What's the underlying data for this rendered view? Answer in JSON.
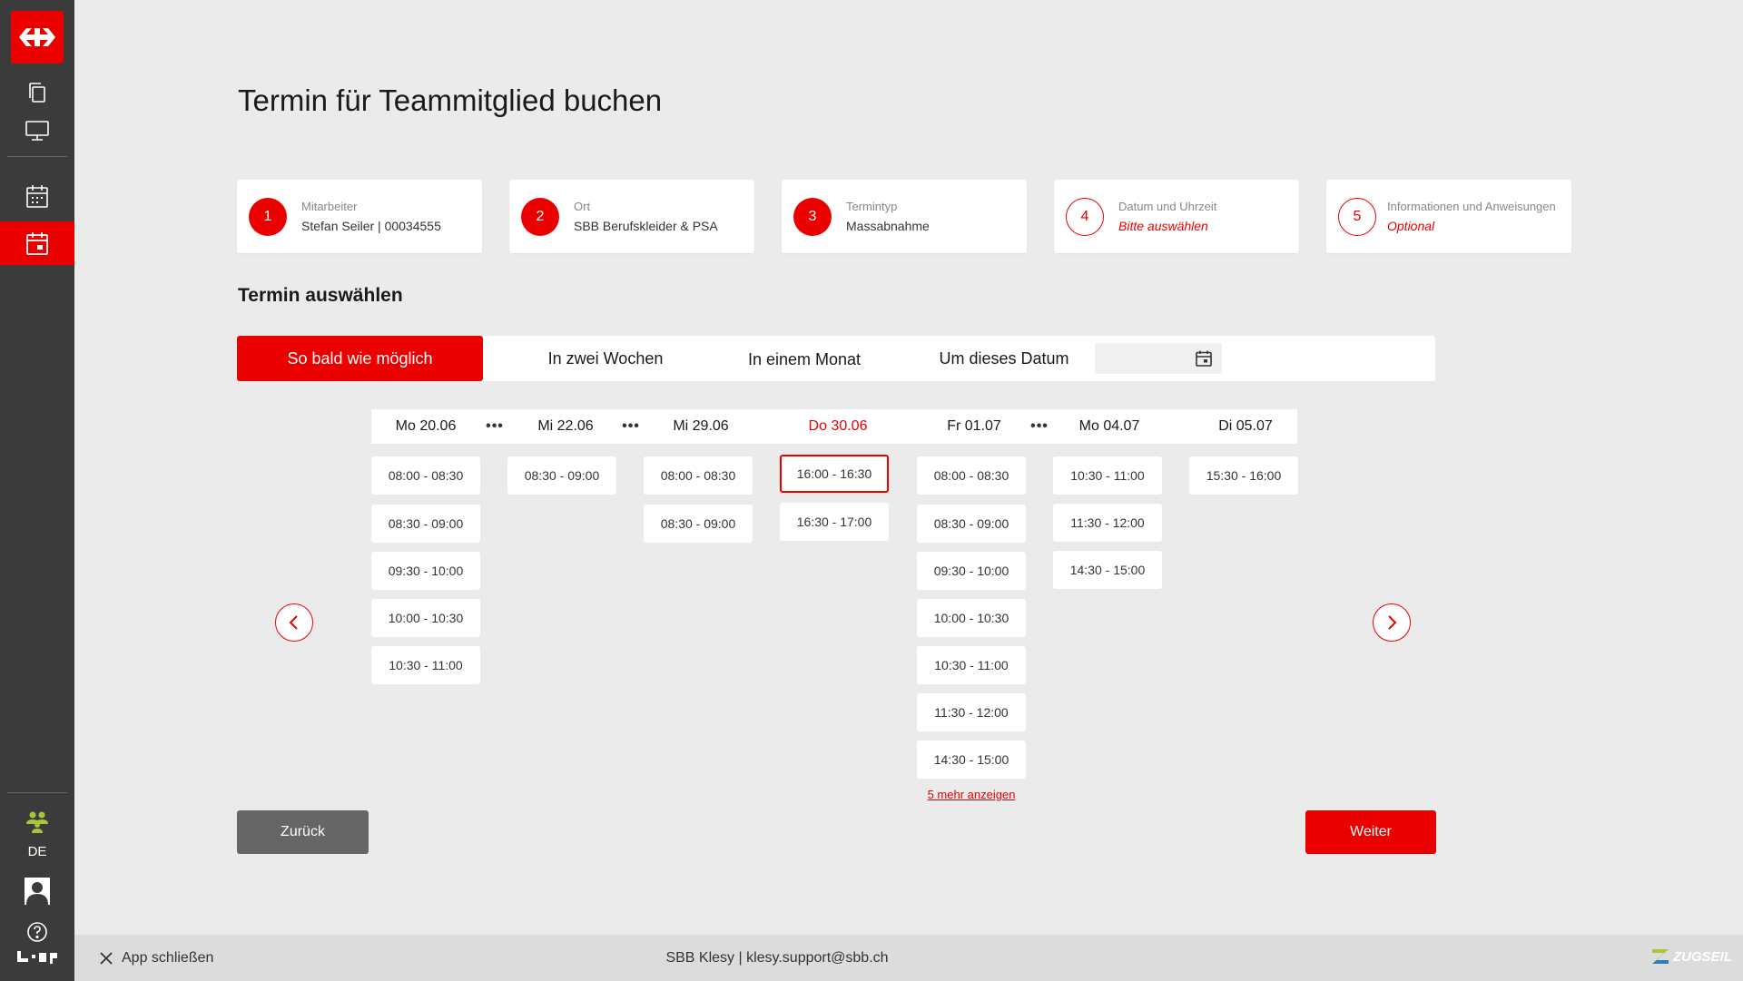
{
  "page": {
    "title": "Termin für Teammitglied buchen",
    "section_title": "Termin auswählen"
  },
  "sidebar": {
    "language": "DE",
    "icons": [
      "sbb-logo-icon",
      "copy-icon",
      "monitor-icon",
      "calendar-icon",
      "calendar-booking-icon",
      "team-icon",
      "user-avatar-icon",
      "help-icon"
    ]
  },
  "steps": [
    {
      "number": "1",
      "label": "Mitarbeiter",
      "value": "Stefan Seiler | 00034555",
      "state": "done"
    },
    {
      "number": "2",
      "label": "Ort",
      "value": "SBB Berufskleider & PSA",
      "state": "done"
    },
    {
      "number": "3",
      "label": "Termintyp",
      "value": "Massabnahme",
      "state": "done"
    },
    {
      "number": "4",
      "label": "Datum und Uhrzeit",
      "value": "Bitte auswählen",
      "state": "current"
    },
    {
      "number": "5",
      "label": "Informationen und Anweisungen",
      "value": "Optional",
      "state": "pending"
    }
  ],
  "filters": {
    "asap": "So bald wie möglich",
    "two_weeks": "In zwei Wochen",
    "one_month": "In einem Monat",
    "this_date": "Um dieses Datum",
    "active": "asap"
  },
  "days": [
    {
      "label": "Mo 20.06",
      "slots": [
        "08:00 - 08:30",
        "08:30 - 09:00",
        "09:30 - 10:00",
        "10:00 - 10:30",
        "10:30 - 11:00"
      ]
    },
    {
      "label": "Mi 22.06",
      "slots": [
        "08:30 - 09:00"
      ]
    },
    {
      "label": "Mi 29.06",
      "slots": [
        "08:00 - 08:30",
        "08:30 - 09:00"
      ]
    },
    {
      "label": "Do 30.06",
      "slots": [
        "16:00 - 16:30",
        "16:30 - 17:00"
      ],
      "highlight": true,
      "selected_slot": "16:00 - 16:30"
    },
    {
      "label": "Fr 01.07",
      "slots": [
        "08:00 - 08:30",
        "08:30 - 09:00",
        "09:30 - 10:00",
        "10:00 - 10:30",
        "10:30 - 11:00",
        "11:30 - 12:00",
        "14:30 - 15:00"
      ],
      "more": "5 mehr anzeigen"
    },
    {
      "label": "Mo 04.07",
      "slots": [
        "10:30 - 11:00",
        "11:30 - 12:00",
        "14:30 - 15:00"
      ]
    },
    {
      "label": "Di 05.07",
      "slots": [
        "15:30 - 16:00"
      ]
    }
  ],
  "gap_marker": "•••",
  "buttons": {
    "back": "Zurück",
    "next": "Weiter"
  },
  "footer": {
    "close_app": "App schließen",
    "support": "SBB Klesy | klesy.support@sbb.ch",
    "brand": "ZUGSEIL"
  },
  "colors": {
    "accent": "#eb0000",
    "sidebar": "#3b3b3b",
    "background": "#ebebeb"
  }
}
